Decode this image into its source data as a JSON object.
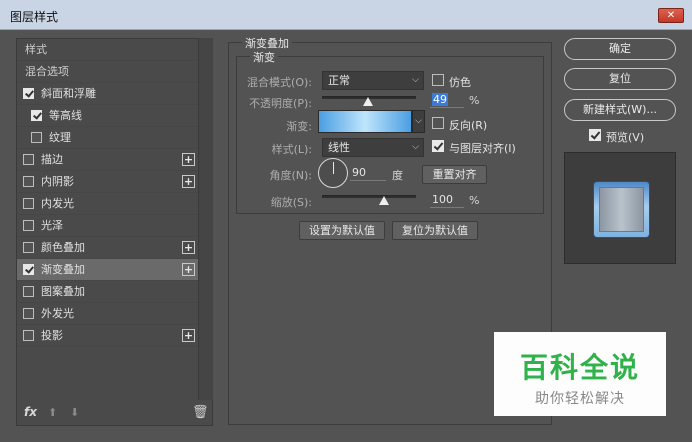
{
  "window": {
    "title": "图层样式",
    "close_glyph": "✕"
  },
  "left_panel": {
    "header_styles": "样式",
    "header_blend": "混合选项",
    "items": [
      {
        "label": "斜面和浮雕",
        "checked": true
      },
      {
        "label": "等高线",
        "checked": true
      },
      {
        "label": "纹理",
        "checked": false
      },
      {
        "label": "描边",
        "checked": false,
        "plus": "+"
      },
      {
        "label": "内阴影",
        "checked": false,
        "plus": "+"
      },
      {
        "label": "内发光",
        "checked": false
      },
      {
        "label": "光泽",
        "checked": false
      },
      {
        "label": "颜色叠加",
        "checked": false,
        "plus": "+"
      },
      {
        "label": "渐变叠加",
        "checked": true,
        "plus": "+",
        "selected": true
      },
      {
        "label": "图案叠加",
        "checked": false
      },
      {
        "label": "外发光",
        "checked": false
      },
      {
        "label": "投影",
        "checked": false,
        "plus": "+"
      }
    ],
    "footer": {
      "fx": "fx",
      "up": "⬆",
      "down": "⬇",
      "trash": "🗑"
    }
  },
  "gradient_overlay": {
    "group_title": "渐变叠加",
    "subgroup_title": "渐变",
    "blend_mode_label": "混合模式(O):",
    "blend_mode_value": "正常",
    "dither_label": "仿色",
    "dither_checked": false,
    "opacity_label": "不透明度(P):",
    "opacity_value": "49",
    "opacity_unit": "%",
    "opacity_level": 49,
    "gradient_label": "渐变:",
    "reverse_label": "反向(R)",
    "reverse_checked": false,
    "style_label": "样式(L):",
    "style_value": "线性",
    "align_label": "与图层对齐(I)",
    "align_checked": true,
    "angle_label": "角度(N):",
    "angle_value": "90",
    "angle_unit": "度",
    "reset_align_label": "重置对齐",
    "scale_label": "缩放(S):",
    "scale_value": "100",
    "scale_unit": "%",
    "scale_level": 100,
    "set_default_label": "设置为默认值",
    "reset_default_label": "复位为默认值",
    "dropdown_glyph": "⌵"
  },
  "right_panel": {
    "ok_label": "确定",
    "reset_label": "复位",
    "new_style_label": "新建样式(W)...",
    "preview_label": "预览(V)",
    "preview_checked": true
  },
  "watermark": {
    "title": "百科全说",
    "subtitle": "助你轻松解决"
  }
}
